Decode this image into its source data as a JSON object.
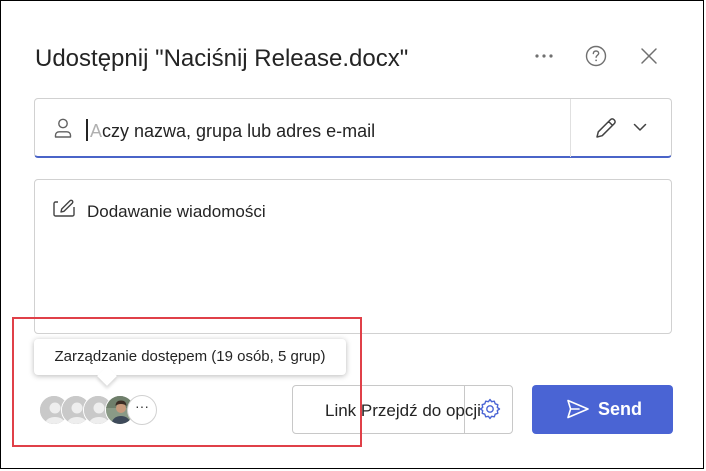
{
  "dialog": {
    "title": "Udostępnij \"Naciśnij Release.docx\"",
    "header_icons": [
      "more-icon",
      "help-icon",
      "close-icon"
    ]
  },
  "to_field": {
    "placeholder_first": "A",
    "placeholder_rest": "czy nazwa, grupa lub adres e-mail",
    "icons": [
      "person-icon",
      "pencil-icon",
      "chevron-down-icon"
    ]
  },
  "message": {
    "placeholder": "Dodawanie wiadomości"
  },
  "access": {
    "tooltip": "Zarządzanie dostępem (19 osób, 5 grup)",
    "more_label": "···"
  },
  "link_button": {
    "label": "Link Przejdź do opcji"
  },
  "send_button": {
    "label": "Send"
  },
  "colors": {
    "accent": "#4a64d4",
    "highlight": "#e04048",
    "input_underline": "#4a64c8"
  }
}
